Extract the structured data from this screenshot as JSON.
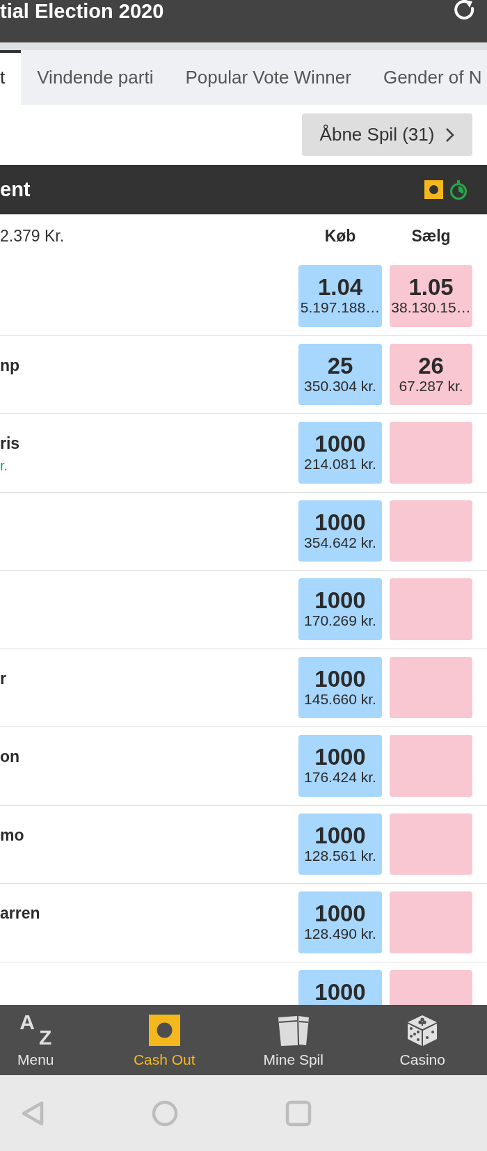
{
  "header": {
    "title": "tial Election 2020"
  },
  "tabs": [
    {
      "label": "t",
      "selected": true
    },
    {
      "label": "Vindende parti",
      "selected": false
    },
    {
      "label": "Popular Vote Winner",
      "selected": false
    },
    {
      "label": "Gender of N",
      "selected": false
    }
  ],
  "open_bets_button": {
    "label": "Åbne Spil (31)"
  },
  "market": {
    "title": "ent",
    "matched": "2.379 Kr.",
    "columns": [
      "Køb",
      "Sælg"
    ],
    "runners": [
      {
        "buy": {
          "odds": "1.04",
          "stake": "5.197.188…"
        },
        "sell": {
          "odds": "1.05",
          "stake": "38.130.15…"
        }
      },
      {
        "name": "np",
        "buy": {
          "odds": "25",
          "stake": "350.304 kr."
        },
        "sell": {
          "odds": "26",
          "stake": "67.287 kr."
        }
      },
      {
        "name": "ris",
        "note": "r.",
        "buy": {
          "odds": "1000",
          "stake": "214.081 kr."
        }
      },
      {
        "buy": {
          "odds": "1000",
          "stake": "354.642 kr."
        }
      },
      {
        "buy": {
          "odds": "1000",
          "stake": "170.269 kr."
        }
      },
      {
        "name": "r",
        "buy": {
          "odds": "1000",
          "stake": "145.660 kr."
        }
      },
      {
        "name": "on",
        "buy": {
          "odds": "1000",
          "stake": "176.424 kr."
        }
      },
      {
        "name": "mo",
        "buy": {
          "odds": "1000",
          "stake": "128.561 kr."
        }
      },
      {
        "name": "arren",
        "buy": {
          "odds": "1000",
          "stake": "128.490 kr."
        }
      },
      {
        "buy": {
          "odds": "1000"
        }
      }
    ]
  },
  "bottom_nav": [
    {
      "kind": "az",
      "label": "Menu",
      "glyphs": [
        "A",
        "Z"
      ],
      "selected": false
    },
    {
      "kind": "cashout",
      "label": "Cash Out",
      "selected": true
    },
    {
      "kind": "tickets",
      "label": "Mine Spil",
      "selected": false
    },
    {
      "kind": "dice",
      "label": "Casino",
      "selected": false
    }
  ]
}
